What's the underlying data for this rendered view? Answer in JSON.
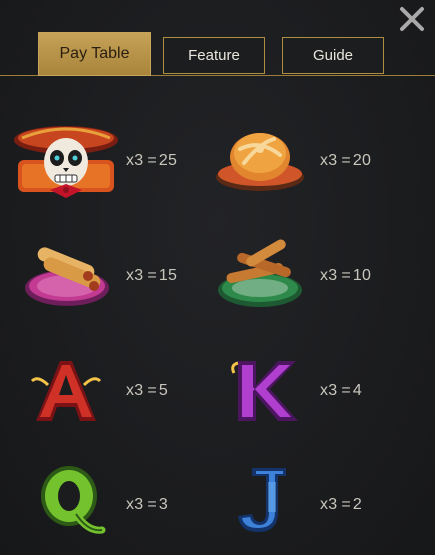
{
  "tabs": [
    {
      "label": "Pay Table",
      "active": true
    },
    {
      "label": "Feature",
      "active": false
    },
    {
      "label": "Guide",
      "active": false
    }
  ],
  "close_icon": "close-icon",
  "paytable": [
    {
      "symbol": "skull-mariachi-icon",
      "count": "x3",
      "eq": "=",
      "payout": "25"
    },
    {
      "symbol": "pan-de-muerto-icon",
      "count": "x3",
      "eq": "=",
      "payout": "20"
    },
    {
      "symbol": "flautas-icon",
      "count": "x3",
      "eq": "=",
      "payout": "15"
    },
    {
      "symbol": "churros-icon",
      "count": "x3",
      "eq": "=",
      "payout": "10"
    },
    {
      "symbol": "letter-a-icon",
      "count": "x3",
      "eq": "=",
      "payout": "5"
    },
    {
      "symbol": "letter-k-icon",
      "count": "x3",
      "eq": "=",
      "payout": "4"
    },
    {
      "symbol": "letter-q-icon",
      "count": "x3",
      "eq": "=",
      "payout": "3"
    },
    {
      "symbol": "letter-j-icon",
      "count": "x3",
      "eq": "=",
      "payout": "2"
    }
  ],
  "colors": {
    "background": "#1b1c1e",
    "tab_active": "#c6a259",
    "tab_border": "#b08e3f",
    "text": "#c9c6bd"
  }
}
